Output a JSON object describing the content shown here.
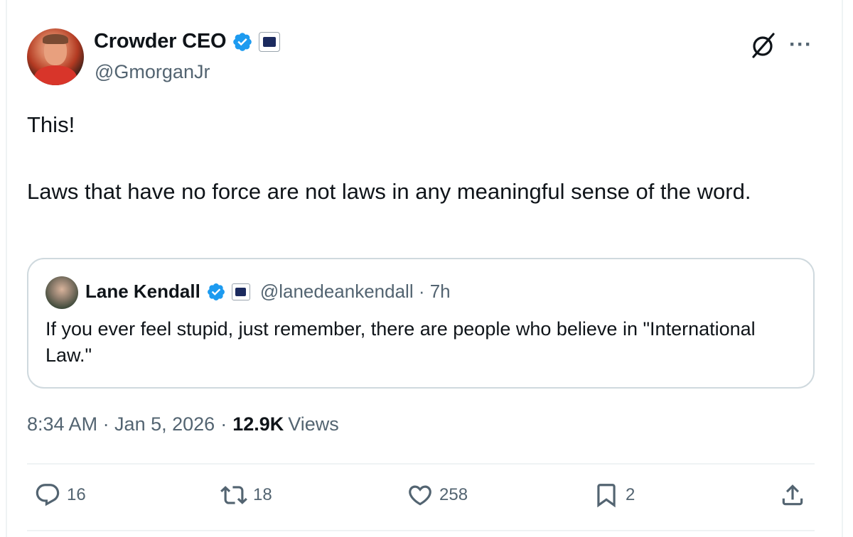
{
  "author": {
    "display_name": "Crowder CEO",
    "handle": "@GmorganJr"
  },
  "tweet": {
    "line1": "This!",
    "line2": "Laws that have no force are not laws in any meaningful sense of the word."
  },
  "quote": {
    "display_name": "Lane Kendall",
    "handle_time": "@lanedeankendall · 7h",
    "text": "If you ever feel stupid, just remember, there are people who believe in \"International Law.\""
  },
  "meta": {
    "time_date": "8:34 AM · Jan 5, 2026",
    "views_count": "12.9K",
    "views_label": "Views"
  },
  "actions": {
    "replies": "16",
    "reposts": "18",
    "likes": "258",
    "bookmarks": "2"
  },
  "colors": {
    "verified": "#1d9bf0",
    "secondary_text": "#536471",
    "primary_text": "#0f1419",
    "border": "#cfd9de"
  },
  "icons": [
    "verified-badge-icon",
    "affiliate-badge-icon",
    "grok-icon",
    "more-icon",
    "reply-icon",
    "repost-icon",
    "like-icon",
    "bookmark-icon",
    "share-icon"
  ]
}
